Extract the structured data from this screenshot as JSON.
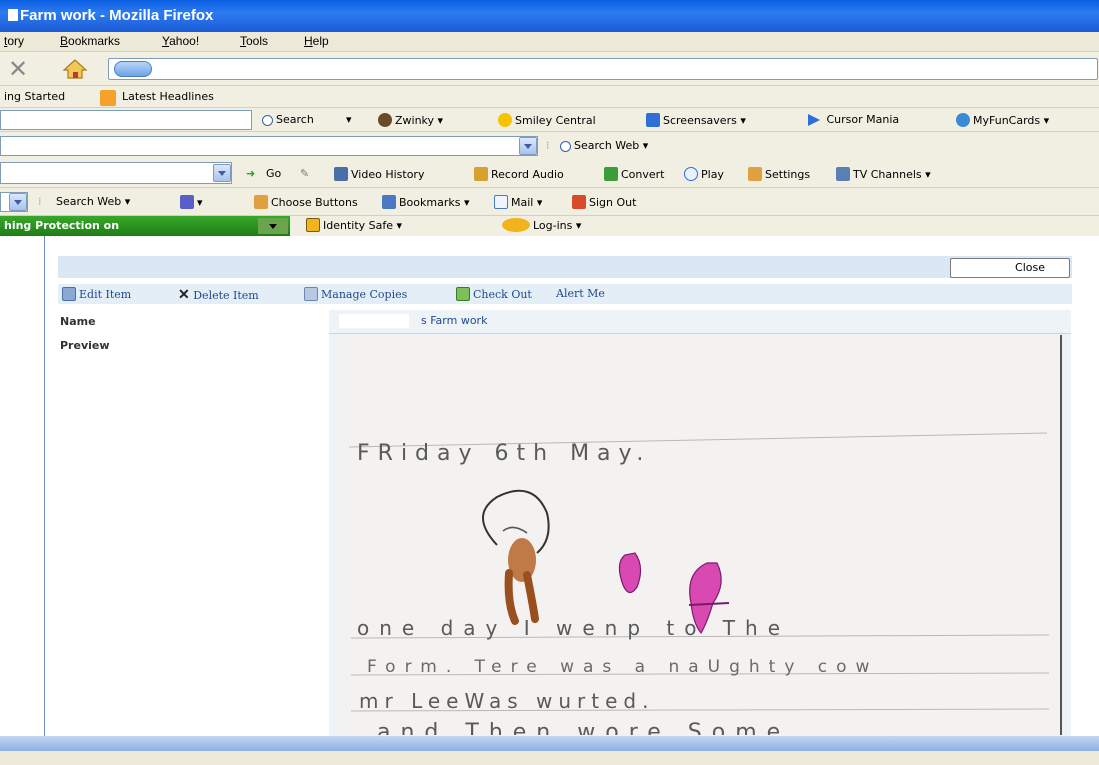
{
  "window": {
    "title": "Farm work - Mozilla Firefox"
  },
  "menu": {
    "items": [
      "tory",
      "Bookmarks",
      "Yahoo!",
      "Tools",
      "Help"
    ]
  },
  "bookmarks_bar": {
    "items": [
      "ing Started",
      "Latest Headlines"
    ]
  },
  "toolbar_search": {
    "search_label": "Search",
    "items": [
      "Zwinky",
      "Smiley Central",
      "Screensavers",
      "Cursor Mania",
      "MyFunCards"
    ]
  },
  "toolbar_video": {
    "search_web_label": "Search Web",
    "items": [
      "Go",
      "Video History",
      "Record Audio",
      "Convert",
      "Play",
      "Settings",
      "TV Channels"
    ]
  },
  "toolbar_yahoo": {
    "items": [
      "Search Web",
      "Choose Buttons",
      "Bookmarks",
      "Mail",
      "Sign Out"
    ]
  },
  "toolbar_protect": {
    "status": "hing Protection on",
    "items": [
      "Identity Safe",
      "Log-ins"
    ]
  },
  "page": {
    "close_label": "Close",
    "actions": [
      "Edit Item",
      "Delete Item",
      "Manage Copies",
      "Check Out",
      "Alert Me"
    ],
    "fields": {
      "name_label": "Name",
      "name_value": "s Farm work",
      "preview_label": "Preview"
    },
    "handwriting": {
      "line1": "FRiday 6th May.",
      "line2": "one day I wenp to The",
      "line3": "Form. Tere was a naUghty cow",
      "line4": "mr LeeWas wurted.",
      "line5": "and Then wore Some"
    }
  },
  "colors": {
    "titlebar": "#0a5ee0",
    "accent_link": "#1e4a8c",
    "protection_green": "#1d7d14"
  }
}
